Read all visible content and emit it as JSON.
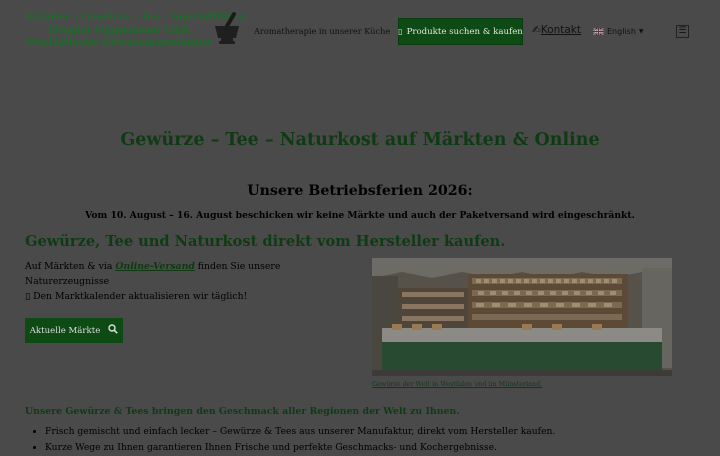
{
  "header": {
    "logo_lines": [
      "Kräuter · Gewürze · Tee · Spezialitäten",
      "Drogist Niggemeier GbR",
      "Westfälische Gewürzmanufaktur"
    ],
    "nav_aroma": "Aromatherapie in unserer Küche",
    "shop_button": "Produkte suchen & kaufen",
    "shop_icon": "cart-icon",
    "contact_label": "Kontakt",
    "contact_icon": "pencil-icon",
    "language": "English",
    "menu_icon": "hamburger-menu-icon"
  },
  "main": {
    "title": "Gewürze – Tee – Naturkost auf Märkten & Online",
    "holiday_heading": "Unsere Betriebsferien 2026:",
    "holiday_notice": "Vom 10. August – 16. August beschicken wir keine Märkte und auch der Paketversand wird eingeschränkt.",
    "section_heading": "Gewürze, Tee und Naturkost direkt vom Hersteller kaufen.",
    "intro_prefix": "Auf Märkten & via ",
    "intro_link": "Online-Versand",
    "intro_suffix": " finden Sie unsere Naturerzeugnisse",
    "intro_line2": "Den Marktkalender aktualisieren wir täglich!",
    "markets_button": "Aktuelle Märkte",
    "image_caption": "Gewürze der Welt in Westfalen und im Münsterland.",
    "tagline": "Unsere Gewürze & Tees bringen den Geschmack aller Regionen der Welt zu Ihnen.",
    "bullets": [
      "Frisch gemischt und einfach lecker – Gewürze & Tees aus unserer Manufaktur, direkt vom Hersteller kaufen.",
      "Kurze Wege zu Ihnen garantieren Ihnen Frische und perfekte Geschmacks- und Kochergebnisse."
    ]
  },
  "colors": {
    "overlay_background": "#4a4a4a",
    "brand_green": "#0d4a14",
    "heading_green": "#0e3b13"
  }
}
